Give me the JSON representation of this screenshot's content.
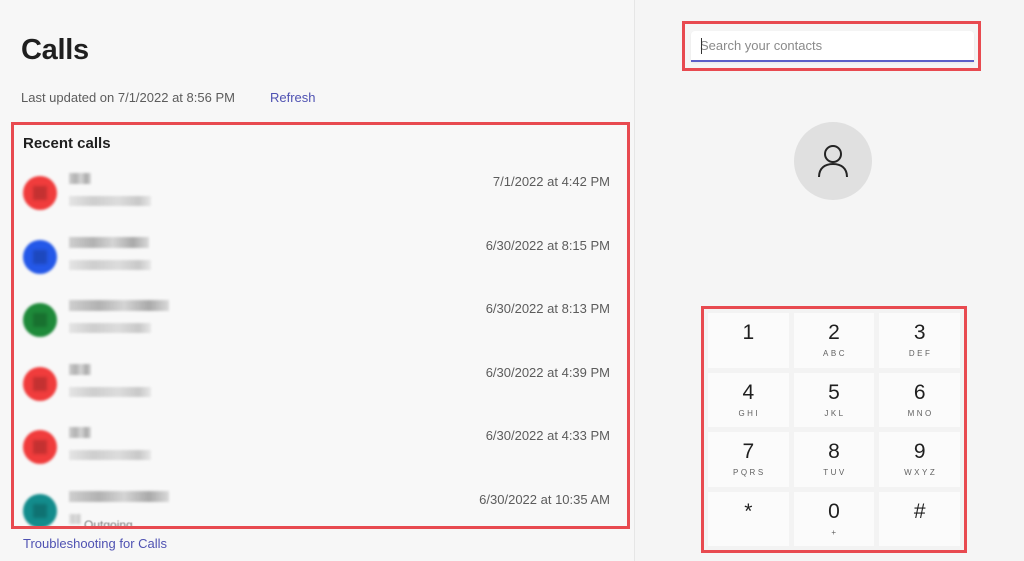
{
  "header": {
    "title": "Calls",
    "last_updated": "Last updated on 7/1/2022 at 8:56 PM",
    "refresh_label": "Refresh"
  },
  "recent_calls": {
    "title": "Recent calls",
    "items": [
      {
        "name": "[redacted]",
        "subtitle": "[redacted]",
        "time": "7/1/2022 at 4:42 PM",
        "avatar_color": "#f03c3c",
        "name_len": "short"
      },
      {
        "name": "[redacted]",
        "subtitle": "[redacted]",
        "time": "6/30/2022 at 8:15 PM",
        "avatar_color": "#2458e8",
        "name_len": "medium"
      },
      {
        "name": "[redacted]",
        "subtitle": "[redacted]",
        "time": "6/30/2022 at 8:13 PM",
        "avatar_color": "#1e8a3a",
        "name_len": "long"
      },
      {
        "name": "[redacted]",
        "subtitle": "[redacted]",
        "time": "6/30/2022 at 4:39 PM",
        "avatar_color": "#f03c3c",
        "name_len": "short"
      },
      {
        "name": "[redacted]",
        "subtitle": "[redacted]",
        "time": "6/30/2022 at 4:33 PM",
        "avatar_color": "#f03c3c",
        "name_len": "short"
      },
      {
        "name": "[redacted]",
        "subtitle": "Outgoing",
        "time": "6/30/2022 at 10:35 AM",
        "avatar_color": "#138c8c",
        "name_len": "long"
      }
    ]
  },
  "footer": {
    "troubleshoot_label": "Troubleshooting for Calls"
  },
  "search": {
    "placeholder": "Search your contacts",
    "value": ""
  },
  "contact_avatar": {
    "icon": "person-icon"
  },
  "dialpad": {
    "keys": [
      {
        "digit": "1",
        "letters": ""
      },
      {
        "digit": "2",
        "letters": "ABC"
      },
      {
        "digit": "3",
        "letters": "DEF"
      },
      {
        "digit": "4",
        "letters": "GHI"
      },
      {
        "digit": "5",
        "letters": "JKL"
      },
      {
        "digit": "6",
        "letters": "MNO"
      },
      {
        "digit": "7",
        "letters": "PQRS"
      },
      {
        "digit": "8",
        "letters": "TUV"
      },
      {
        "digit": "9",
        "letters": "WXYZ"
      },
      {
        "digit": "*",
        "letters": ""
      },
      {
        "digit": "0",
        "letters": "+"
      },
      {
        "digit": "#",
        "letters": ""
      }
    ]
  },
  "colors": {
    "accent": "#5b5fc7",
    "link": "#4f52b2",
    "highlight_outline": "#e84a50"
  }
}
